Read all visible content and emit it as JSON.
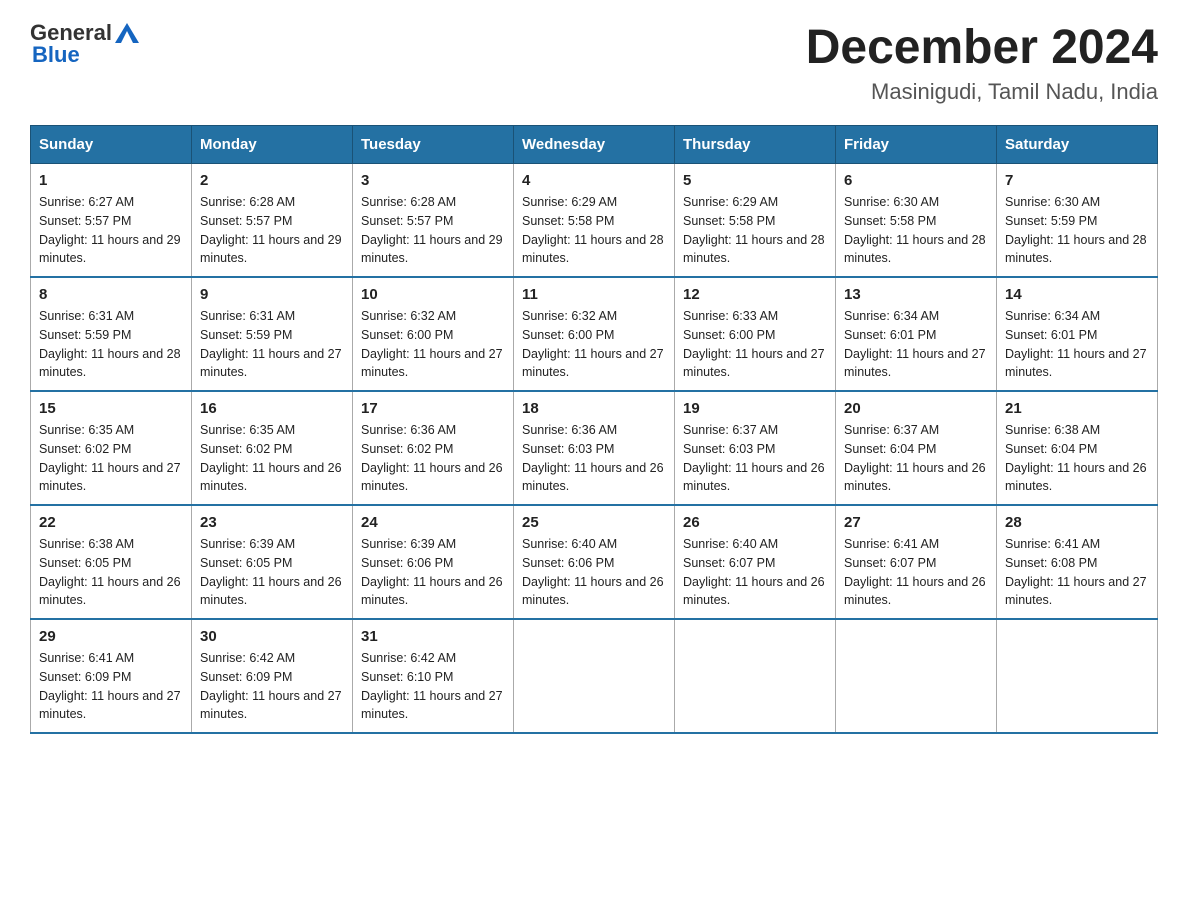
{
  "logo": {
    "text_general": "General",
    "text_blue": "Blue"
  },
  "title": {
    "month_year": "December 2024",
    "location": "Masinigudi, Tamil Nadu, India"
  },
  "days_of_week": [
    "Sunday",
    "Monday",
    "Tuesday",
    "Wednesday",
    "Thursday",
    "Friday",
    "Saturday"
  ],
  "weeks": [
    [
      {
        "day": "1",
        "sunrise": "6:27 AM",
        "sunset": "5:57 PM",
        "daylight": "11 hours and 29 minutes."
      },
      {
        "day": "2",
        "sunrise": "6:28 AM",
        "sunset": "5:57 PM",
        "daylight": "11 hours and 29 minutes."
      },
      {
        "day": "3",
        "sunrise": "6:28 AM",
        "sunset": "5:57 PM",
        "daylight": "11 hours and 29 minutes."
      },
      {
        "day": "4",
        "sunrise": "6:29 AM",
        "sunset": "5:58 PM",
        "daylight": "11 hours and 28 minutes."
      },
      {
        "day": "5",
        "sunrise": "6:29 AM",
        "sunset": "5:58 PM",
        "daylight": "11 hours and 28 minutes."
      },
      {
        "day": "6",
        "sunrise": "6:30 AM",
        "sunset": "5:58 PM",
        "daylight": "11 hours and 28 minutes."
      },
      {
        "day": "7",
        "sunrise": "6:30 AM",
        "sunset": "5:59 PM",
        "daylight": "11 hours and 28 minutes."
      }
    ],
    [
      {
        "day": "8",
        "sunrise": "6:31 AM",
        "sunset": "5:59 PM",
        "daylight": "11 hours and 28 minutes."
      },
      {
        "day": "9",
        "sunrise": "6:31 AM",
        "sunset": "5:59 PM",
        "daylight": "11 hours and 27 minutes."
      },
      {
        "day": "10",
        "sunrise": "6:32 AM",
        "sunset": "6:00 PM",
        "daylight": "11 hours and 27 minutes."
      },
      {
        "day": "11",
        "sunrise": "6:32 AM",
        "sunset": "6:00 PM",
        "daylight": "11 hours and 27 minutes."
      },
      {
        "day": "12",
        "sunrise": "6:33 AM",
        "sunset": "6:00 PM",
        "daylight": "11 hours and 27 minutes."
      },
      {
        "day": "13",
        "sunrise": "6:34 AM",
        "sunset": "6:01 PM",
        "daylight": "11 hours and 27 minutes."
      },
      {
        "day": "14",
        "sunrise": "6:34 AM",
        "sunset": "6:01 PM",
        "daylight": "11 hours and 27 minutes."
      }
    ],
    [
      {
        "day": "15",
        "sunrise": "6:35 AM",
        "sunset": "6:02 PM",
        "daylight": "11 hours and 27 minutes."
      },
      {
        "day": "16",
        "sunrise": "6:35 AM",
        "sunset": "6:02 PM",
        "daylight": "11 hours and 26 minutes."
      },
      {
        "day": "17",
        "sunrise": "6:36 AM",
        "sunset": "6:02 PM",
        "daylight": "11 hours and 26 minutes."
      },
      {
        "day": "18",
        "sunrise": "6:36 AM",
        "sunset": "6:03 PM",
        "daylight": "11 hours and 26 minutes."
      },
      {
        "day": "19",
        "sunrise": "6:37 AM",
        "sunset": "6:03 PM",
        "daylight": "11 hours and 26 minutes."
      },
      {
        "day": "20",
        "sunrise": "6:37 AM",
        "sunset": "6:04 PM",
        "daylight": "11 hours and 26 minutes."
      },
      {
        "day": "21",
        "sunrise": "6:38 AM",
        "sunset": "6:04 PM",
        "daylight": "11 hours and 26 minutes."
      }
    ],
    [
      {
        "day": "22",
        "sunrise": "6:38 AM",
        "sunset": "6:05 PM",
        "daylight": "11 hours and 26 minutes."
      },
      {
        "day": "23",
        "sunrise": "6:39 AM",
        "sunset": "6:05 PM",
        "daylight": "11 hours and 26 minutes."
      },
      {
        "day": "24",
        "sunrise": "6:39 AM",
        "sunset": "6:06 PM",
        "daylight": "11 hours and 26 minutes."
      },
      {
        "day": "25",
        "sunrise": "6:40 AM",
        "sunset": "6:06 PM",
        "daylight": "11 hours and 26 minutes."
      },
      {
        "day": "26",
        "sunrise": "6:40 AM",
        "sunset": "6:07 PM",
        "daylight": "11 hours and 26 minutes."
      },
      {
        "day": "27",
        "sunrise": "6:41 AM",
        "sunset": "6:07 PM",
        "daylight": "11 hours and 26 minutes."
      },
      {
        "day": "28",
        "sunrise": "6:41 AM",
        "sunset": "6:08 PM",
        "daylight": "11 hours and 27 minutes."
      }
    ],
    [
      {
        "day": "29",
        "sunrise": "6:41 AM",
        "sunset": "6:09 PM",
        "daylight": "11 hours and 27 minutes."
      },
      {
        "day": "30",
        "sunrise": "6:42 AM",
        "sunset": "6:09 PM",
        "daylight": "11 hours and 27 minutes."
      },
      {
        "day": "31",
        "sunrise": "6:42 AM",
        "sunset": "6:10 PM",
        "daylight": "11 hours and 27 minutes."
      },
      null,
      null,
      null,
      null
    ]
  ],
  "labels": {
    "sunrise": "Sunrise:",
    "sunset": "Sunset:",
    "daylight": "Daylight:"
  }
}
